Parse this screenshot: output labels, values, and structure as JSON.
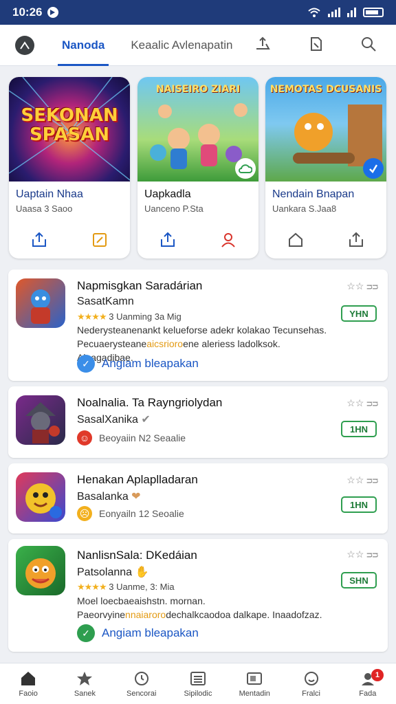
{
  "status_bar": {
    "time": "10:26"
  },
  "top_tabs": {
    "active": "Nanoda",
    "second": "Keaalic Avlenapatin"
  },
  "featured": [
    {
      "art_text": "SEKONAN SPASAN",
      "title": "Uaptain Nhaa",
      "subtitle": "Uaasa 3 Saoo"
    },
    {
      "art_text": "NAISEIRO ZIARI",
      "title": "Uapkadla",
      "subtitle": "Uanceno P.Sta"
    },
    {
      "art_text": "NEMOTAS DCUSANIS",
      "title": "Nendain Bnapan",
      "subtitle": "Uankara S.Jaa8"
    }
  ],
  "list": [
    {
      "name": "Napmisgkan Saradárian",
      "developer": "SasatKamn",
      "rating_stars": "★★★★",
      "rating_text": "3 Uanming 3a Mig",
      "desc_line1": "Nederysteanenankt kelueforse adekr kolakao Tecunsehas.",
      "desc_line2_pre": "Pecuaerysteane",
      "desc_line2_em": "aicsrioro",
      "desc_line2_post": "ene aleriess ladolksok. Alnagadibae.",
      "promo": "Angiam bleapakan",
      "top_stars": "☆☆ ᴝᴝ",
      "install": "YHN"
    },
    {
      "name": "Noalnalia. Ta Rayngriolydan",
      "developer": "SasalXanika",
      "meta": "Beoyaiin N2 Seaalie",
      "top_stars": "☆☆ ᴝᴝ",
      "install": "1HN"
    },
    {
      "name": "Henakan Aplaplladaran",
      "developer": "Basalanka",
      "meta": "Eonyailn 12 Seoalie",
      "top_stars": "☆☆ ᴝᴝ",
      "install": "1HN"
    },
    {
      "name": "NanlisnSala: DKedáian",
      "developer": "Patsolanna",
      "rating_stars": "★★★★",
      "rating_text": "3 Uanme, 3: Mia",
      "desc_line1": "Moel loecbaeaishstn. mornan.",
      "desc_line2_pre": "Paeorvyine",
      "desc_line2_em": "nnaiaroro",
      "desc_line2_post": "dechalkcaodoa dalkape. Inaadofzaz.",
      "promo": "Angiam bleapakan",
      "top_stars": "☆☆ ᴝᴝ",
      "install": "SHN"
    }
  ],
  "bottom_nav": [
    {
      "label": "Faoio"
    },
    {
      "label": "Sanek"
    },
    {
      "label": "Sencorai"
    },
    {
      "label": "Sipilodic"
    },
    {
      "label": "Mentadin"
    },
    {
      "label": "Fralci"
    },
    {
      "label": "Fada",
      "badge": "1"
    }
  ],
  "colors": {
    "status_bar": "#1f3b7a",
    "accent": "#1a56c4",
    "install": "#2e9e4f"
  }
}
